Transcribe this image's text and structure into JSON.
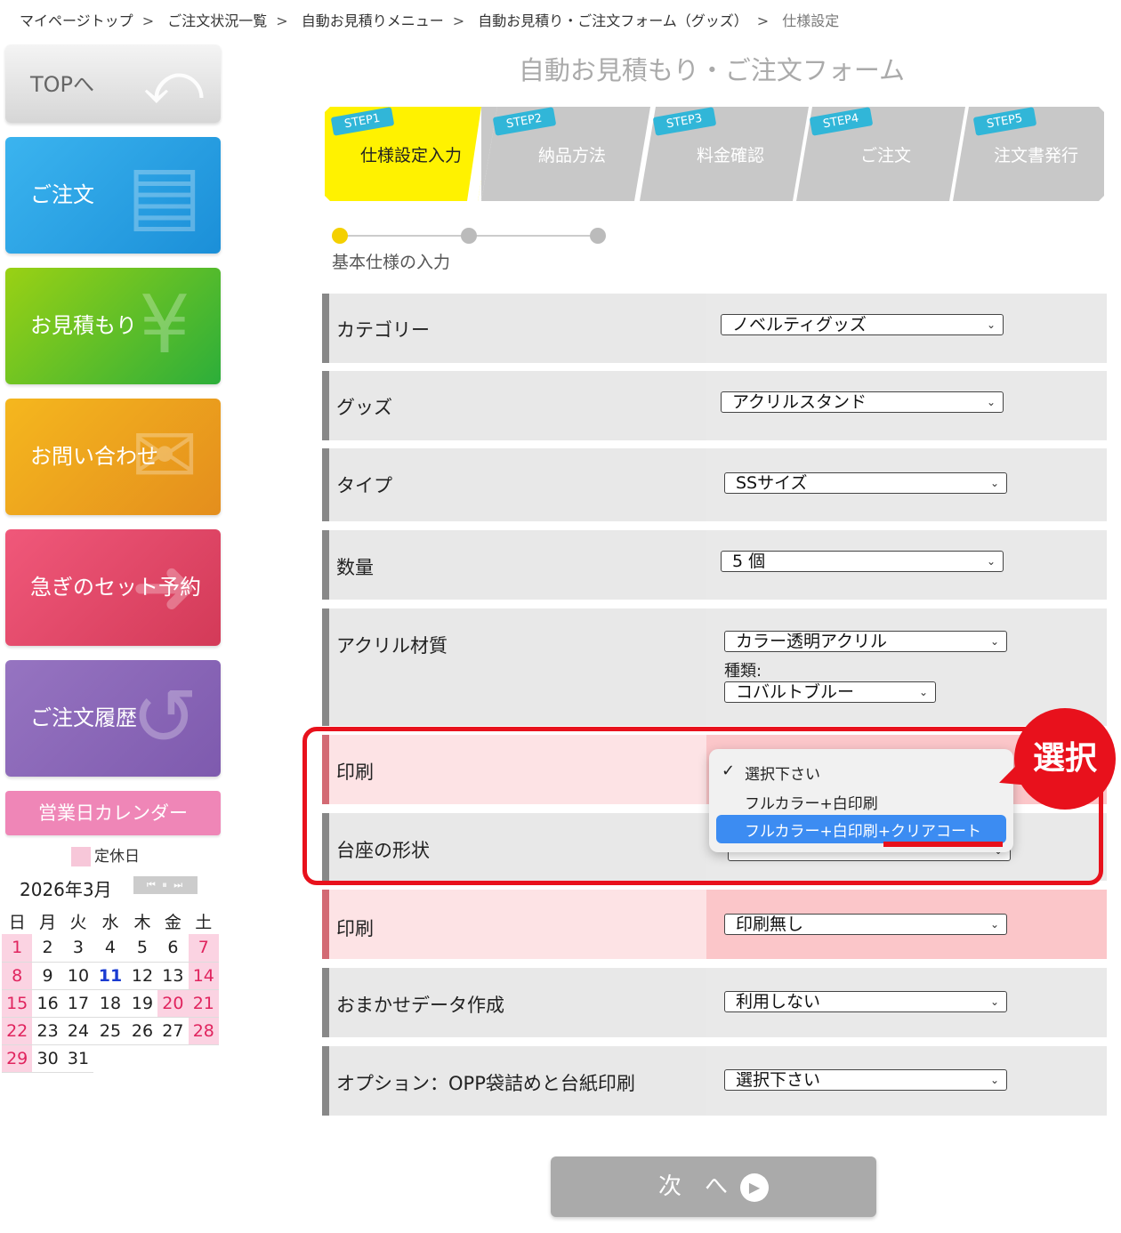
{
  "breadcrumb": [
    {
      "label": "マイページトップ"
    },
    {
      "label": "ご注文状況一覧"
    },
    {
      "label": "自動お見積りメニュー"
    },
    {
      "label": "自動お見積り・ご注文フォーム（グッズ）"
    },
    {
      "label": "仕様設定"
    }
  ],
  "sidebar": {
    "top": "TOPへ",
    "order": "ご注文",
    "estimate": "お見積もり",
    "inquiry": "お問い合わせ",
    "rush": "急ぎのセット予約",
    "history": "ご注文履歴",
    "calendar_button": "営業日カレンダー",
    "legend_holiday": "定休日",
    "month": "2026年3月",
    "weekdays": [
      "日",
      "月",
      "火",
      "水",
      "木",
      "金",
      "土"
    ],
    "weeks": [
      [
        "1",
        "2",
        "3",
        "4",
        "5",
        "6",
        "7"
      ],
      [
        "8",
        "9",
        "10",
        "11",
        "12",
        "13",
        "14"
      ],
      [
        "15",
        "16",
        "17",
        "18",
        "19",
        "20",
        "21"
      ],
      [
        "22",
        "23",
        "24",
        "25",
        "26",
        "27",
        "28"
      ],
      [
        "29",
        "30",
        "31",
        "",
        "",
        "",
        ""
      ]
    ],
    "holidays": [
      "1",
      "7",
      "8",
      "14",
      "15",
      "20",
      "21",
      "22",
      "28",
      "29"
    ],
    "today": "11"
  },
  "page_title": "自動お見積もり・ご注文フォーム",
  "steps": [
    {
      "tag": "STEP1",
      "label": "仕様設定入力",
      "active": true
    },
    {
      "tag": "STEP2",
      "label": "納品方法"
    },
    {
      "tag": "STEP3",
      "label": "料金確認"
    },
    {
      "tag": "STEP4",
      "label": "ご注文"
    },
    {
      "tag": "STEP5",
      "label": "注文書発行"
    }
  ],
  "progress_label": "基本仕様の入力",
  "form": {
    "category": {
      "label": "カテゴリー",
      "value": "ノベルティグッズ"
    },
    "goods": {
      "label": "グッズ",
      "value": "アクリルスタンド"
    },
    "type": {
      "label": "タイプ",
      "value": "SSサイズ"
    },
    "quantity": {
      "label": "数量",
      "value": "5 個"
    },
    "material": {
      "label": "アクリル材質",
      "value": "カラー透明アクリル",
      "sub_label": "種類:",
      "sub_value": "コバルトブルー"
    },
    "print1": {
      "label": "印刷"
    },
    "base": {
      "label": "台座の形状"
    },
    "print2": {
      "label": "印刷",
      "value": "印刷無し"
    },
    "data": {
      "label": "おまかせデータ作成",
      "value": "利用しない"
    },
    "option": {
      "label": "オプション：OPP袋詰めと台紙印刷",
      "value": "選択下さい"
    }
  },
  "dropdown": {
    "options": [
      "選択下さい",
      "フルカラー+白印刷",
      "フルカラー+白印刷+クリアコート"
    ],
    "checked": "選択下さい",
    "highlighted": "フルカラー+白印刷+クリアコート"
  },
  "callout": "選択",
  "next_button": "次　へ",
  "colors": {
    "accent_red": "#e8111c",
    "step_active": "#fff200",
    "step_tag": "#31b6d8",
    "highlight_blue": "#3c8cf2"
  }
}
